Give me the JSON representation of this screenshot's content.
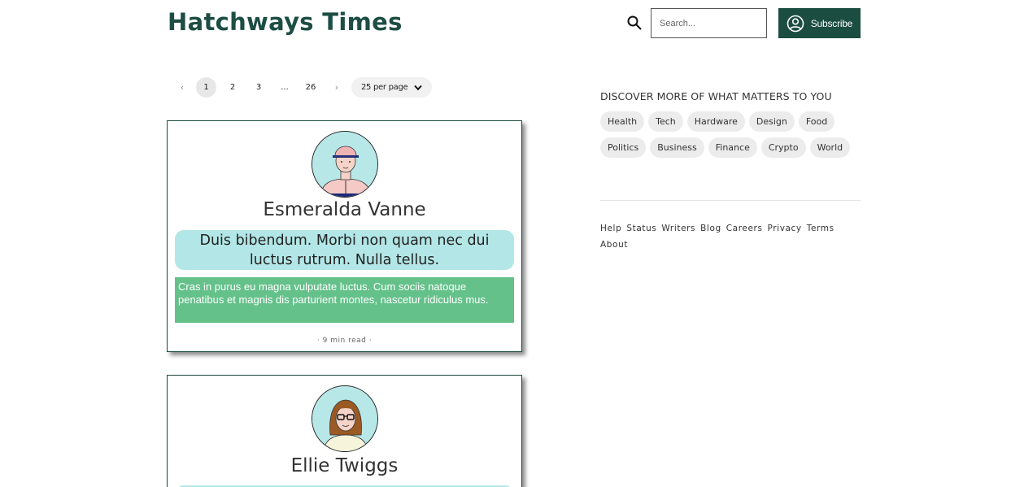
{
  "header": {
    "brand": "Hatchways Times",
    "search_placeholder": "Search...",
    "subscribe_label": "Subscribe"
  },
  "pagination": {
    "prev": "‹",
    "pages": [
      "1",
      "2",
      "3",
      "...",
      "26"
    ],
    "current": "1",
    "next": "›",
    "per_page": "25 per page"
  },
  "posts": [
    {
      "author": "Esmeralda Vanne",
      "title": "Duis bibendum. Morbi non quam nec dui luctus rutrum. Nulla tellus.",
      "excerpt": "Cras in purus eu magna vulputate luctus. Cum sociis natoque penatibus et magnis dis parturient montes, nascetur ridiculus mus.",
      "meta": "· 9 min read ·",
      "avatar_icon": "man-cap-avatar-icon"
    },
    {
      "author": "Ellie Twiggs",
      "avatar_icon": "woman-glasses-avatar-icon"
    }
  ],
  "sidebar": {
    "discover_title": "DISCOVER MORE OF WHAT MATTERS TO YOU",
    "tags": [
      "Health",
      "Tech",
      "Hardware",
      "Design",
      "Food",
      "Politics",
      "Business",
      "Finance",
      "Crypto",
      "World"
    ],
    "footer_links": [
      "Help",
      "Status",
      "Writers",
      "Blog",
      "Careers",
      "Privacy",
      "Terms",
      "About"
    ]
  },
  "colors": {
    "brand": "#1d4d44",
    "subscribe_bg": "#1b4d41",
    "title_box": "#b3e6e6",
    "excerpt_box": "#64c18a",
    "chip_bg": "#ececec"
  }
}
